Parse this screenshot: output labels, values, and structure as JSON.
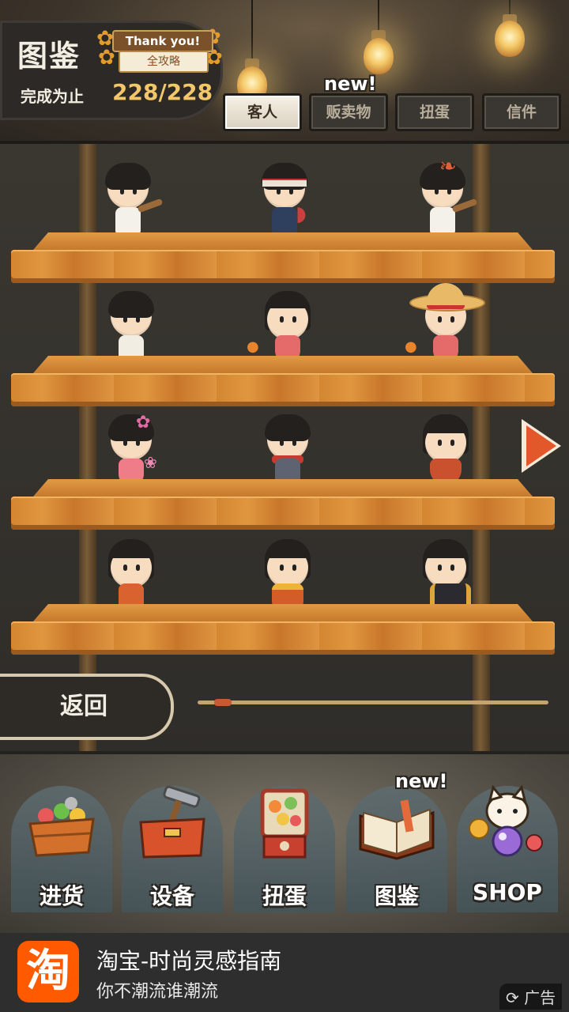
{
  "header": {
    "title": "图鉴",
    "progress_label": "完成为止",
    "progress_value": "228/228",
    "badge_top": "Thank you!",
    "badge_bottom": "全攻略"
  },
  "tabs": [
    {
      "label": "客人",
      "active": true
    },
    {
      "label": "贩卖物",
      "active": false,
      "new": "new!"
    },
    {
      "label": "扭蛋",
      "active": false
    },
    {
      "label": "信件",
      "active": false
    }
  ],
  "shelf_figures": [
    [
      "boy-bat",
      "boy-headband",
      "boy-bat-hat"
    ],
    [
      "boy-glasses",
      "girl-pink",
      "girl-strawhat"
    ],
    [
      "girl-flowers",
      "girl-scarf",
      "girl-bob-orange"
    ],
    [
      "girl-kimono-orange",
      "girl-bob-yellow",
      "girl-bob-black"
    ]
  ],
  "back_button": "返回",
  "scroll_progress": 0.05,
  "menu": [
    {
      "label": "进货",
      "icon": "basket-icon"
    },
    {
      "label": "设备",
      "icon": "toolbox-icon"
    },
    {
      "label": "扭蛋",
      "icon": "gacha-machine-icon"
    },
    {
      "label": "图鉴",
      "icon": "book-icon",
      "new": "new!"
    },
    {
      "label": "SHOP",
      "icon": "lucky-cat-icon"
    }
  ],
  "ad": {
    "logo": "淘",
    "title": "淘宝-时尚灵感指南",
    "subtitle": "你不潮流谁潮流",
    "tag": "广告"
  },
  "colors": {
    "accent": "#e2582b",
    "gold": "#f2c66a",
    "wood": "#d48631",
    "ad_brand": "#ff5a00"
  }
}
